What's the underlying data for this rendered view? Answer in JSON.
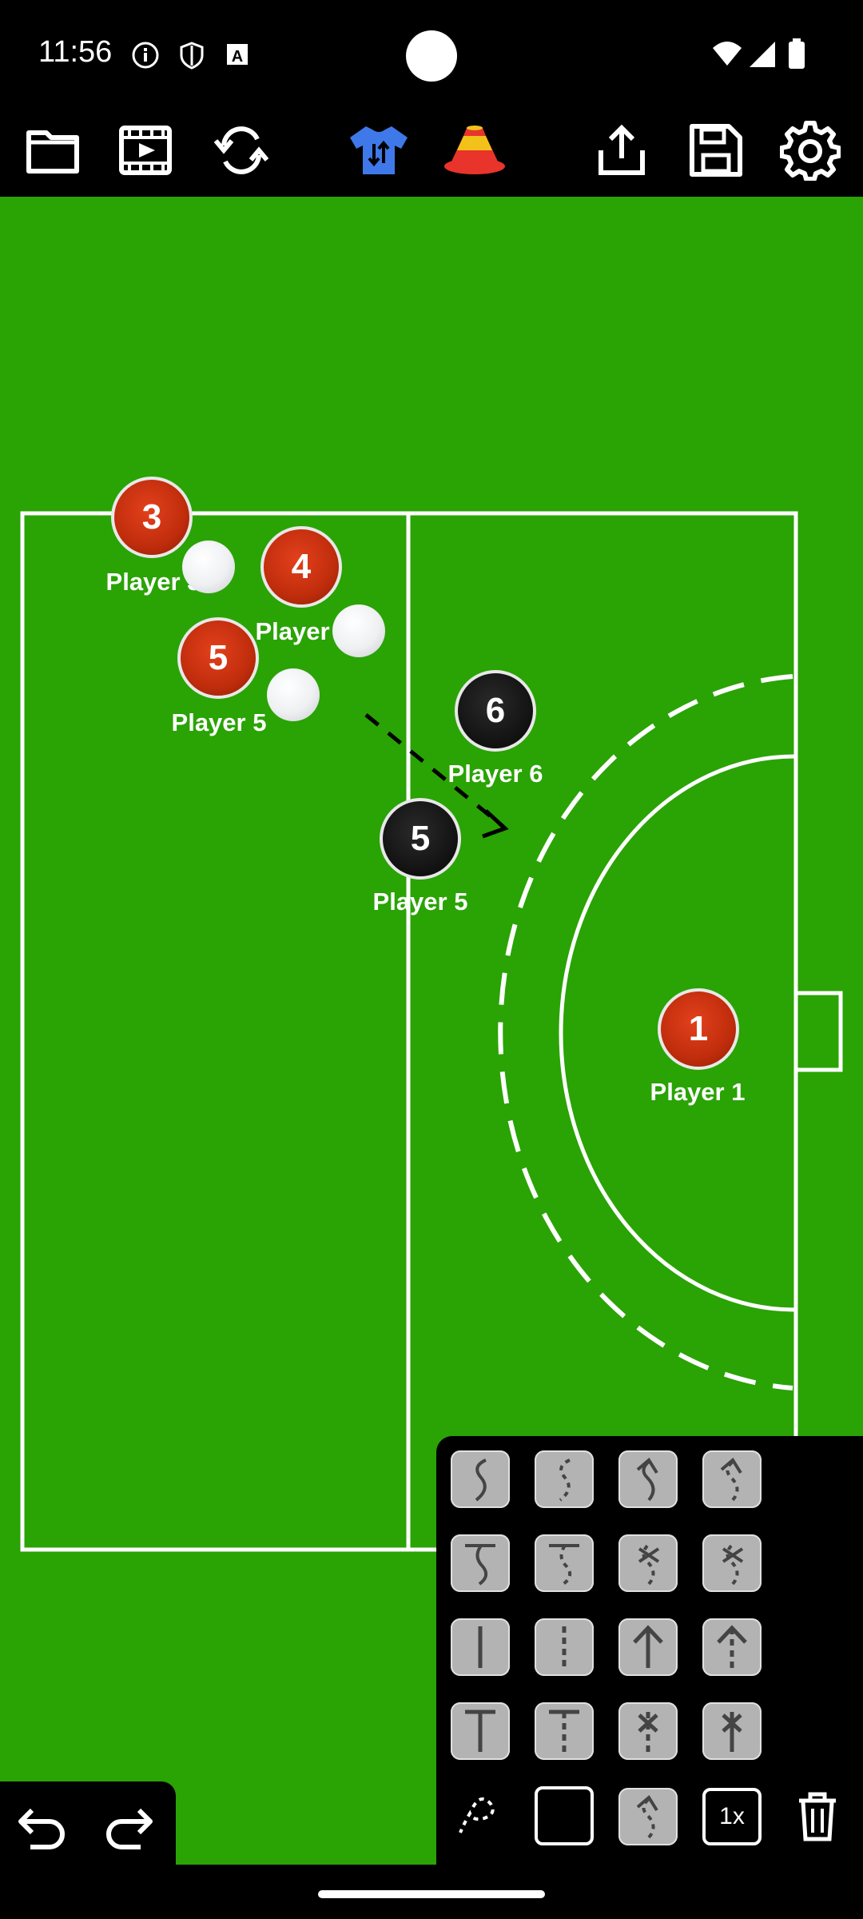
{
  "status_bar": {
    "time": "11:56",
    "icons": [
      "info-icon",
      "shield-icon",
      "a-icon",
      "wifi-icon",
      "signal-icon",
      "battery-icon"
    ]
  },
  "toolbar": {
    "items": [
      {
        "name": "open-folder-icon"
      },
      {
        "name": "animation-player-icon"
      },
      {
        "name": "sync-icon"
      },
      {
        "name": "swap-team-shirt-icon"
      },
      {
        "name": "cones-icon"
      },
      {
        "name": "share-icon"
      },
      {
        "name": "save-icon"
      },
      {
        "name": "settings-gear-icon"
      }
    ]
  },
  "colors": {
    "field": "#2aa305",
    "team_red": "#c8310f",
    "team_black": "#111111",
    "lines": "#ffffff",
    "tool_tile": "#b3b3b3"
  },
  "players": [
    {
      "number": "3",
      "label": "Player 3",
      "team": "red"
    },
    {
      "number": "4",
      "label": "Player",
      "team": "red"
    },
    {
      "number": "5",
      "label": "Player 5",
      "team": "red"
    },
    {
      "number": "6",
      "label": "Player 6",
      "team": "black"
    },
    {
      "number": "5",
      "label": "Player 5",
      "team": "black"
    },
    {
      "number": "1",
      "label": "Player 1",
      "team": "red"
    }
  ],
  "drawing_tools": {
    "rows": [
      [
        "curve-solid-icon",
        "curve-dashed-icon",
        "curve-arrow-icon",
        "curve-dashed-arrow-icon"
      ],
      [
        "curve-t-icon",
        "curve-dashed-t-icon",
        "curve-cross-icon",
        "curve-dashed-cross-icon"
      ],
      [
        "line-solid-icon",
        "line-dashed-icon",
        "line-arrow-icon",
        "line-dashed-arrow-icon"
      ],
      [
        "line-t-icon",
        "line-dashed-t-icon",
        "line-cross-icon",
        "line-dashed-cross-icon"
      ]
    ],
    "bottom": {
      "freehand": "freehand-lasso-icon",
      "rectangle": "rectangle-icon",
      "selected": "selected-tool-icon",
      "speed_label": "1x",
      "delete": "trash-icon"
    }
  },
  "history": {
    "undo": "undo-icon",
    "redo": "redo-icon"
  }
}
